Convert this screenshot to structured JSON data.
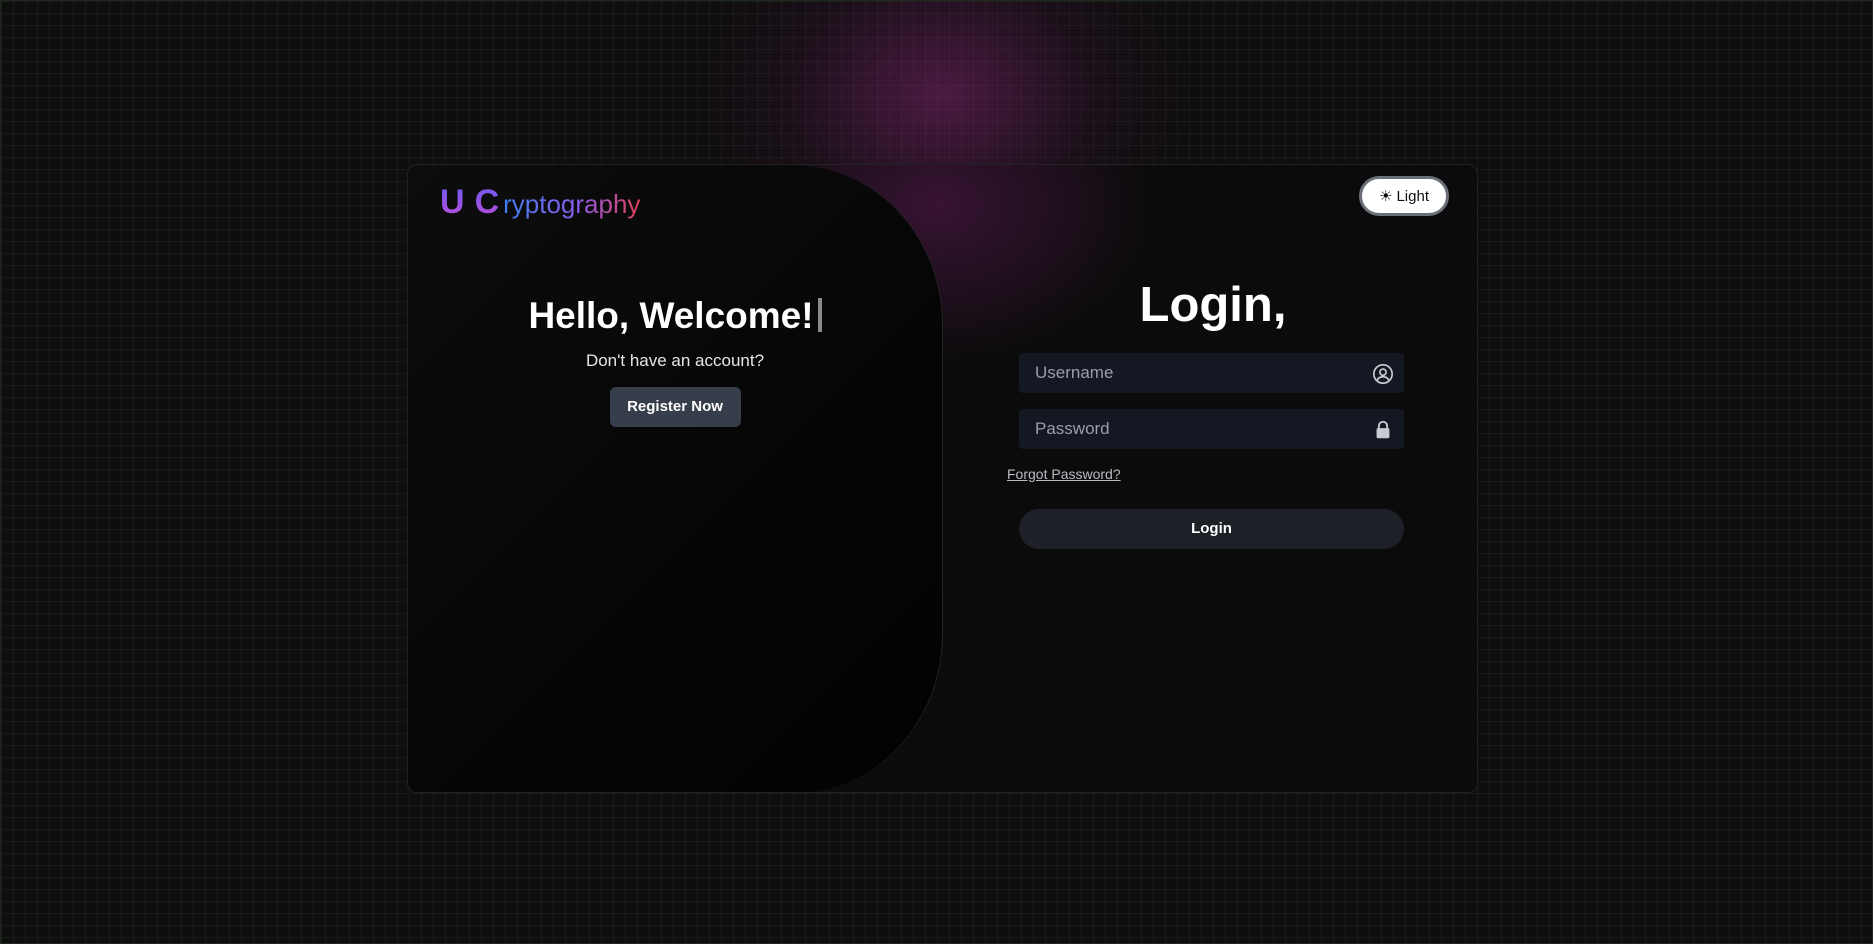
{
  "logo": {
    "letter_u": "U",
    "letter_c": "C",
    "rest": "ryptography"
  },
  "theme_toggle": {
    "icon": "sun-icon",
    "glyph": "☀",
    "label": "Light"
  },
  "welcome": {
    "title": "Hello, Welcome!",
    "subtitle": "Don't have an account?",
    "register_label": "Register Now"
  },
  "login": {
    "title": "Login,",
    "username_placeholder": "Username",
    "username_icon": "user-circle-icon",
    "password_placeholder": "Password",
    "password_icon": "lock-icon",
    "forgot_label": "Forgot Password?",
    "submit_label": "Login"
  },
  "colors": {
    "background": "#0e0e0e",
    "card": "#0b0b0b",
    "field_bg": "#141822",
    "register_bg": "#363d4b",
    "login_btn_bg": "#1d2026",
    "accent_glow": "#96288a",
    "logo_gradient_start": "#3f7ef0",
    "logo_gradient_end": "#e0405a"
  }
}
